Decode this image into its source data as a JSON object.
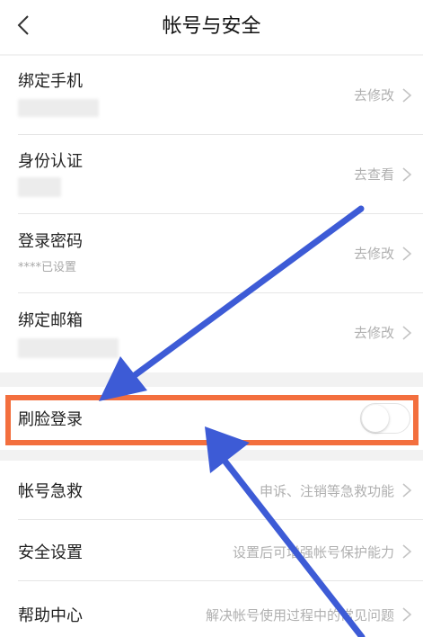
{
  "header": {
    "title": "帐号与安全",
    "back_icon": "chevron-left-icon"
  },
  "account_rows": [
    {
      "label": "绑定手机",
      "sub": "",
      "action": "去修改"
    },
    {
      "label": "身份认证",
      "sub": "",
      "action": "去查看"
    },
    {
      "label": "登录密码",
      "sub": "****已设置",
      "action": "去修改"
    },
    {
      "label": "绑定邮箱",
      "sub": "",
      "action": "去修改"
    }
  ],
  "face_login": {
    "label": "刷脸登录",
    "enabled": false
  },
  "other_rows": [
    {
      "label": "帐号急救",
      "action": "申诉、注销等急救功能"
    },
    {
      "label": "安全设置",
      "action": "设置后可增强帐号保护能力"
    },
    {
      "label": "帮助中心",
      "action": "解决帐号使用过程中的常见问题"
    }
  ],
  "colors": {
    "highlight": "#f36f3e",
    "arrow": "#3d5bd6",
    "background": "#f2f2f2"
  }
}
